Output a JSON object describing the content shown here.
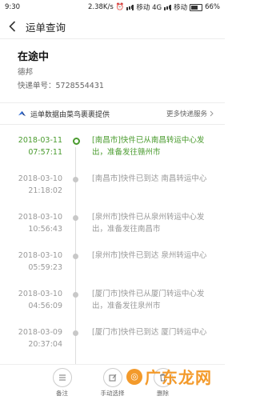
{
  "status_bar": {
    "time": "9:30",
    "network_speed": "2.38K/s",
    "carrier_one": "移动 4G",
    "carrier_two": "移动",
    "battery": "66%"
  },
  "nav": {
    "title": "运单查询"
  },
  "summary": {
    "state": "在途中",
    "carrier": "德邦",
    "tracking_number": "快递单号：5728554431"
  },
  "provider": {
    "label": "运单数据由菜鸟裹裹提供",
    "more_services": "更多快递服务"
  },
  "events": [
    {
      "date": "2018-03-11",
      "time": "07:57:11",
      "text": "[南昌市]快件已从南昌转运中心发出，准备发往赣州市",
      "active": true
    },
    {
      "date": "2018-03-10",
      "time": "21:18:02",
      "text": "[南昌市]快件已到达 南昌转运中心",
      "active": false
    },
    {
      "date": "2018-03-10",
      "time": "10:56:43",
      "text": "[泉州市]快件已从泉州转运中心发出，准备发往南昌市",
      "active": false
    },
    {
      "date": "2018-03-10",
      "time": "05:59:23",
      "text": "[泉州市]快件已到达 泉州转运中心",
      "active": false
    },
    {
      "date": "2018-03-10",
      "time": "04:56:09",
      "text": "[厦门市]快件已从厦门转运中心发出，准备发往泉州市",
      "active": false
    },
    {
      "date": "2018-03-09",
      "time": "20:37:04",
      "text": "[厦门市]快件已到达 厦门转运中心",
      "active": false
    }
  ],
  "bottom_bar": {
    "note_label": "备注",
    "manual_select_label": "手动选择",
    "delete_label": "删除"
  },
  "watermark": {
    "text": "广东龙网"
  },
  "colors": {
    "active_green": "#4a9b2e",
    "watermark_orange": "#f39a2b"
  },
  "icons": {
    "back": "chevron-left-icon",
    "provider": "cainiao-bird-icon",
    "more": "chevron-right-icon",
    "note": "note-icon",
    "manual_select": "edit-icon",
    "delete": "trash-icon"
  }
}
